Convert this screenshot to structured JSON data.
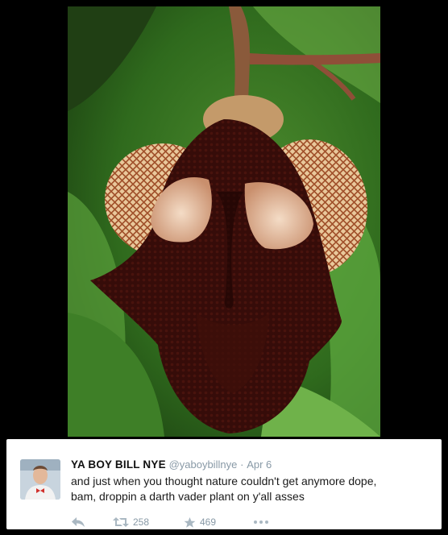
{
  "tweet": {
    "display_name": "YA BOY BILL NYE",
    "handle": "@yaboybillnye",
    "separator": "·",
    "date": "Apr 6",
    "text_line1": "and just when you thought nature couldn't get anymore dope,",
    "text_line2": "bam, droppin a darth vader plant on y'all asses",
    "retweet_count": "258",
    "favorite_count": "469",
    "icons": [
      "reply-icon",
      "retweet-icon",
      "favorite-icon",
      "more-icon"
    ]
  },
  "colors": {
    "background": "#000000",
    "card": "#ffffff",
    "muted": "#8899a6",
    "icon": "#aab8c2"
  }
}
